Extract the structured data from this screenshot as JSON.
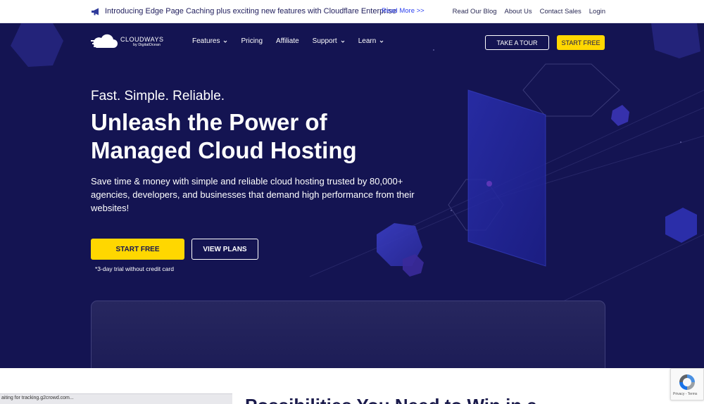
{
  "announcement": {
    "icon": "megaphone-icon",
    "text": "Introducing Edge Page Caching plus exciting new features with Cloudflare Enterprise",
    "link": "Read More >>"
  },
  "top_links": [
    "Read Our Blog",
    "About Us",
    "Contact Sales",
    "Login"
  ],
  "logo": {
    "brand": "CLOUDWAYS",
    "sub": "by DigitalOcean",
    "icon": "cloud-logo-icon"
  },
  "nav": [
    {
      "label": "Features",
      "dropdown": true
    },
    {
      "label": "Pricing",
      "dropdown": false
    },
    {
      "label": "Affiliate",
      "dropdown": false
    },
    {
      "label": "Support",
      "dropdown": true
    },
    {
      "label": "Learn",
      "dropdown": true
    }
  ],
  "header_buttons": {
    "tour": "TAKE A TOUR",
    "start": "START FREE"
  },
  "hero": {
    "tagline": "Fast. Simple. Reliable.",
    "headline_1": "Unleash the Power of",
    "headline_2": "Managed Cloud Hosting",
    "description": "Save time & money with simple and reliable cloud hosting trusted by 80,000+ agencies, developers, and businesses that demand high performance from their websites!",
    "cta_primary": "START FREE",
    "cta_secondary": "VIEW PLANS",
    "trial_note": "*3-day trial without credit card"
  },
  "status_bar": "aiting for tracking.g2crowd.com...",
  "next_section_heading": "Possibilities You Need to Win in a",
  "recaptcha": {
    "text": "Privacy - Terms",
    "icon": "recaptcha-icon"
  },
  "colors": {
    "navy": "#141452",
    "accent_yellow": "#ffd700",
    "link_blue": "#2b3ff0"
  }
}
